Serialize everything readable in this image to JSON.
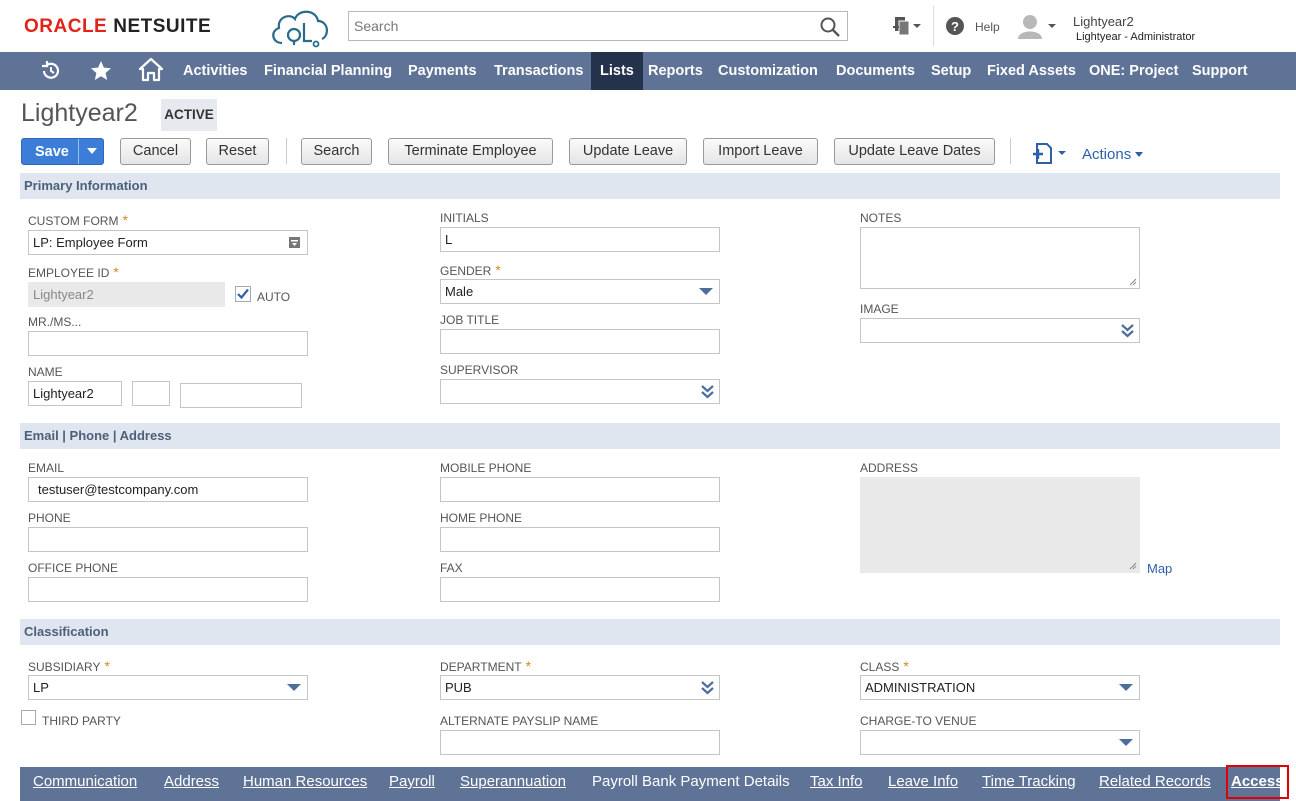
{
  "header": {
    "logo_oracle": "ORACLE",
    "logo_netsuite": "NETSUITE",
    "search_placeholder": "Search",
    "help_label": "Help",
    "user_name": "Lightyear2",
    "user_role": "Lightyear - Administrator"
  },
  "nav": {
    "items": [
      "Activities",
      "Financial Planning",
      "Payments",
      "Transactions",
      "Lists",
      "Reports",
      "Customization",
      "Documents",
      "Setup",
      "Fixed Assets",
      "ONE: Project",
      "Support"
    ],
    "active": "Lists"
  },
  "record": {
    "title": "Lightyear2",
    "status": "ACTIVE"
  },
  "toolbar": {
    "save": "Save",
    "cancel": "Cancel",
    "reset": "Reset",
    "search": "Search",
    "terminate": "Terminate Employee",
    "update_leave": "Update Leave",
    "import_leave": "Import Leave",
    "update_leave_dates": "Update Leave Dates",
    "actions": "Actions"
  },
  "primary": {
    "header": "Primary Information",
    "custom_form_label": "CUSTOM FORM",
    "custom_form_value": "LP:  Employee Form",
    "employee_id_label": "EMPLOYEE ID",
    "employee_id_value": "Lightyear2",
    "auto_label": "AUTO",
    "mrms_label": "MR./MS...",
    "name_label": "NAME",
    "name_first": "Lightyear2",
    "initials_label": "INITIALS",
    "initials_value": "L",
    "gender_label": "GENDER",
    "gender_value": "Male",
    "job_title_label": "JOB TITLE",
    "supervisor_label": "SUPERVISOR",
    "notes_label": "NOTES",
    "image_label": "IMAGE"
  },
  "contact": {
    "header": "Email | Phone | Address",
    "email_label": "EMAIL",
    "email_value": "testuser@testcompany.com",
    "phone_label": "PHONE",
    "office_phone_label": "OFFICE PHONE",
    "mobile_label": "MOBILE PHONE",
    "home_phone_label": "HOME PHONE",
    "fax_label": "FAX",
    "address_label": "ADDRESS",
    "map_link": "Map"
  },
  "classification": {
    "header": "Classification",
    "subsidiary_label": "SUBSIDIARY",
    "subsidiary_value": "LP",
    "third_party_label": "THIRD PARTY",
    "department_label": "DEPARTMENT",
    "department_value": "PUB",
    "alt_payslip_label": "ALTERNATE PAYSLIP NAME",
    "class_label": "CLASS",
    "class_value": "ADMINISTRATION",
    "charge_venue_label": "CHARGE-TO VENUE"
  },
  "tabs": {
    "items": [
      "Communication",
      "Address",
      "Human Resources",
      "Payroll",
      "Superannuation",
      "Payroll Bank Payment Details",
      "Tax Info",
      "Leave Info",
      "Time Tracking",
      "Related Records",
      "Access"
    ],
    "active": "Access"
  },
  "colors": {
    "nav_bg": "#5f7397",
    "nav_active": "#25324b",
    "section_bg": "#e0e6ef",
    "save_blue": "#3c7dd8",
    "required": "#d08b1e",
    "highlight": "#e00000"
  }
}
